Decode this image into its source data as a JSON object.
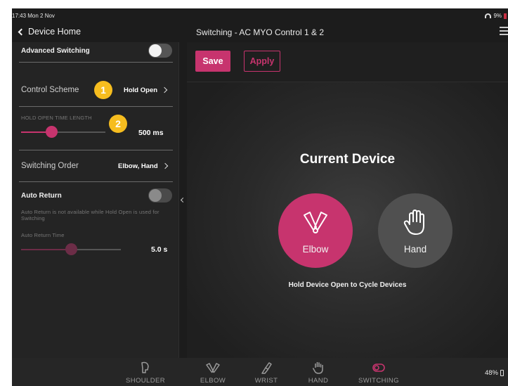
{
  "status_bar": {
    "time": "17:43  Mon 2 Nov",
    "battery": "9%"
  },
  "nav": {
    "back_label": "Device Home",
    "title": "Switching - AC MYO Control 1 & 2"
  },
  "left_panel": {
    "advanced_switching": {
      "label": "Advanced Switching",
      "enabled": true
    },
    "control_scheme": {
      "label": "Control Scheme",
      "value": "Hold Open",
      "badge": "1"
    },
    "hold_open": {
      "caption": "HOLD OPEN TIME LENGTH",
      "value": "500 ms",
      "badge": "2",
      "slider_fraction": 0.36
    },
    "switching_order": {
      "label": "Switching Order",
      "value": "Elbow, Hand"
    },
    "auto_return": {
      "label": "Auto Return",
      "enabled": false,
      "note": "Auto Return is not available while Hold Open is used for Switching",
      "time_caption": "Auto Return Time",
      "time_value": "5.0 s",
      "slider_fraction": 0.5
    }
  },
  "toolbar": {
    "save_label": "Save",
    "apply_label": "Apply"
  },
  "main": {
    "title": "Current Device",
    "devices": [
      {
        "label": "Elbow",
        "active": true,
        "icon": "elbow-icon"
      },
      {
        "label": "Hand",
        "active": false,
        "icon": "hand-icon"
      }
    ],
    "hint": "Hold Device Open to Cycle Devices"
  },
  "tab_bar": {
    "tabs": [
      {
        "label": "SHOULDER",
        "icon": "shoulder-icon",
        "active": false
      },
      {
        "label": "ELBOW",
        "icon": "elbow-icon",
        "active": false
      },
      {
        "label": "WRIST",
        "icon": "wrist-icon",
        "active": false
      },
      {
        "label": "HAND",
        "icon": "hand-icon",
        "active": false
      },
      {
        "label": "SWITCHING",
        "icon": "toggle-icon",
        "active": true
      }
    ],
    "battery": "48%"
  },
  "colors": {
    "accent": "#c7346e",
    "badge": "#f6bd1f",
    "background": "#1c1c1c"
  }
}
